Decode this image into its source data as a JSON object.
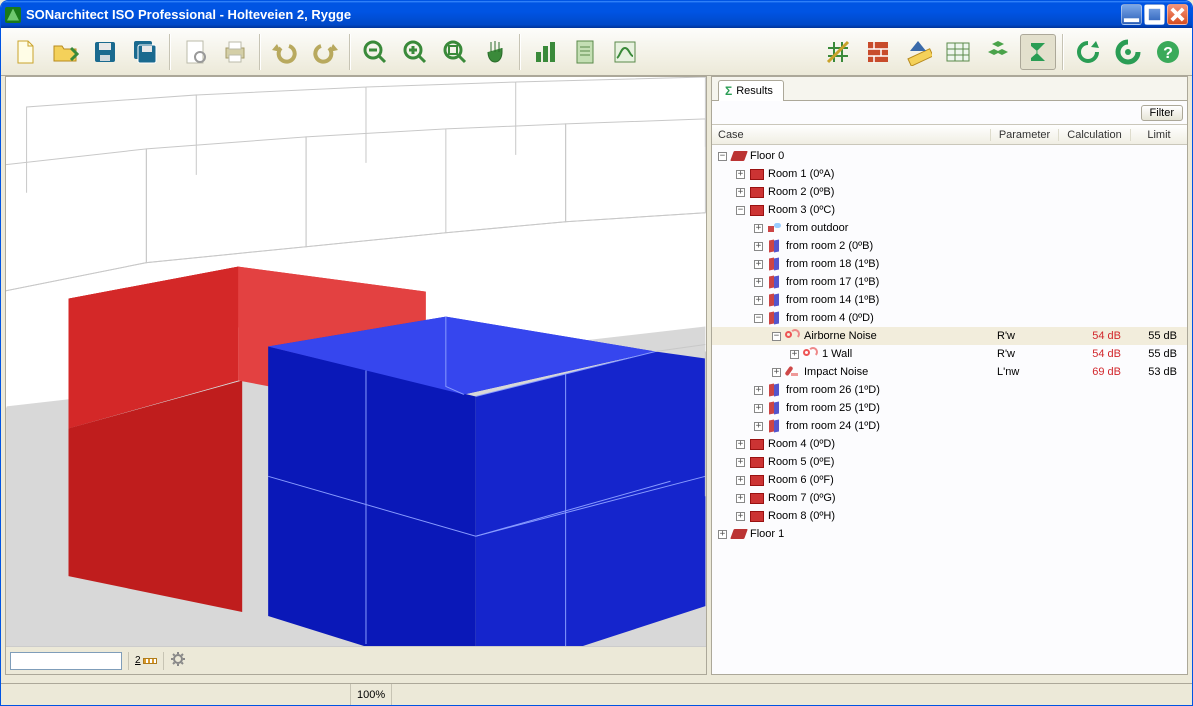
{
  "window": {
    "title": "SONarchitect ISO Professional - Holteveien 2, Rygge"
  },
  "toolbar_icons": [
    "new-file-icon",
    "open-folder-icon",
    "save-icon",
    "save-project-icon",
    "sep",
    "page-settings-icon",
    "print-icon",
    "sep",
    "undo-icon",
    "redo-icon",
    "sep",
    "zoom-out-icon",
    "zoom-in-icon",
    "zoom-fit-icon",
    "pan-icon",
    "sep",
    "barchart-icon",
    "report-icon",
    "spectrum-icon",
    "spacer",
    "grid-toggle-icon",
    "wall-layers-icon",
    "ruler-icon",
    "table-icon",
    "boxes-icon",
    "sigma-icon",
    "sep",
    "refresh-icon",
    "apply-icon",
    "help-icon"
  ],
  "results": {
    "tab_label": "Results",
    "filter_label": "Filter",
    "columns": {
      "case": "Case",
      "parameter": "Parameter",
      "calculation": "Calculation",
      "limit": "Limit"
    }
  },
  "tree": [
    {
      "d": 0,
      "x": "-",
      "ic": "floor",
      "t": "Floor 0"
    },
    {
      "d": 1,
      "x": "+",
      "ic": "room",
      "t": "Room 1 (0ºA)"
    },
    {
      "d": 1,
      "x": "+",
      "ic": "room",
      "t": "Room 2 (0ºB)"
    },
    {
      "d": 1,
      "x": "-",
      "ic": "room",
      "t": "Room 3 (0ºC)"
    },
    {
      "d": 2,
      "x": "+",
      "ic": "outdoor",
      "t": "from outdoor"
    },
    {
      "d": 2,
      "x": "+",
      "ic": "wall",
      "t": "from room 2 (0ºB)"
    },
    {
      "d": 2,
      "x": "+",
      "ic": "wall",
      "t": "from room 18 (1ºB)"
    },
    {
      "d": 2,
      "x": "+",
      "ic": "wall",
      "t": "from room 17 (1ºB)"
    },
    {
      "d": 2,
      "x": "+",
      "ic": "wall",
      "t": "from room 14 (1ºB)"
    },
    {
      "d": 2,
      "x": "-",
      "ic": "wall",
      "t": "from room 4 (0ºD)"
    },
    {
      "d": 3,
      "x": "-",
      "ic": "air",
      "t": "Airborne Noise",
      "sel": true,
      "param": "R'w",
      "calc": "54 dB",
      "limit": "55 dB",
      "red": true
    },
    {
      "d": 4,
      "x": "+",
      "ic": "air",
      "t": "1 Wall",
      "param": "R'w",
      "calc": "54 dB",
      "limit": "55 dB",
      "red": true
    },
    {
      "d": 3,
      "x": "+",
      "ic": "impact",
      "t": "Impact Noise",
      "param": "L'nw",
      "calc": "69 dB",
      "limit": "53 dB",
      "red": true
    },
    {
      "d": 2,
      "x": "+",
      "ic": "wall",
      "t": "from room 26 (1ºD)"
    },
    {
      "d": 2,
      "x": "+",
      "ic": "wall",
      "t": "from room 25 (1ºD)"
    },
    {
      "d": 2,
      "x": "+",
      "ic": "wall",
      "t": "from room 24 (1ºD)"
    },
    {
      "d": 1,
      "x": "+",
      "ic": "room",
      "t": "Room 4 (0ºD)"
    },
    {
      "d": 1,
      "x": "+",
      "ic": "room",
      "t": "Room 5 (0ºE)"
    },
    {
      "d": 1,
      "x": "+",
      "ic": "room",
      "t": "Room 6 (0ºF)"
    },
    {
      "d": 1,
      "x": "+",
      "ic": "room",
      "t": "Room 7 (0ºG)"
    },
    {
      "d": 1,
      "x": "+",
      "ic": "room",
      "t": "Room 8 (0ºH)"
    },
    {
      "d": 0,
      "x": "+",
      "ic": "floor",
      "t": "Floor 1"
    }
  ],
  "status": {
    "progress_text": "100%"
  },
  "viewport_tools": {
    "dim_label": "2"
  }
}
